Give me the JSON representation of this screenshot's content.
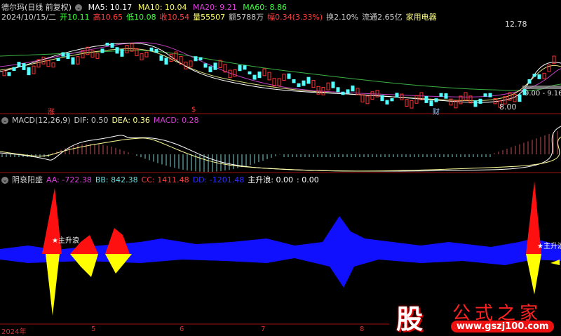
{
  "header": {
    "stock_title": "德尔玛(日线 前复权)",
    "ma5": "MA5: 10.17",
    "ma10": "MA10: 10.04",
    "ma20": "MA20: 9.21",
    "ma60": "MA60: 8.86",
    "date": "2024/10/15/二",
    "open": "开10.11",
    "high": "高10.65",
    "low": "低10.08",
    "close": "收10.54",
    "volume": "量55507",
    "amount": "额5788万",
    "change": "幅0.34(3.33%)",
    "turnover": "换2.10%",
    "float_cap": "流通2.65亿",
    "industry": "家用电器"
  },
  "price_panel": {
    "high_label": "12.78",
    "low_label": "8.00",
    "cost_label": "9.00 - 9.16",
    "markers": [
      "涨",
      "$",
      "财"
    ]
  },
  "macd": {
    "title": "MACD(12,26,9)",
    "dif": "DIF: 0.50",
    "dea": "DEA: 0.36",
    "macd": "MACD: 0.28"
  },
  "indicator": {
    "title": "阴衰阳盛",
    "aa": "AA: -722.38",
    "bb": "BB: 842.38",
    "cc": "CC: 1411.48",
    "dd": "DD: -1201.48",
    "main_wave": "主升浪: 0.00",
    "extra": ": 0.00",
    "signal_label": "主升浪"
  },
  "xaxis": {
    "labels": [
      "2024年",
      "5",
      "6",
      "7",
      "8"
    ]
  },
  "watermark": {
    "badge": "股",
    "name": "公式之家",
    "url": "www.gszj100.com"
  },
  "colors": {
    "up": "#ff3232",
    "down": "#54ffff",
    "ma5": "#ffffff",
    "ma10": "#ffff00",
    "ma20": "#ff00ff",
    "ma60": "#00ff00"
  }
}
